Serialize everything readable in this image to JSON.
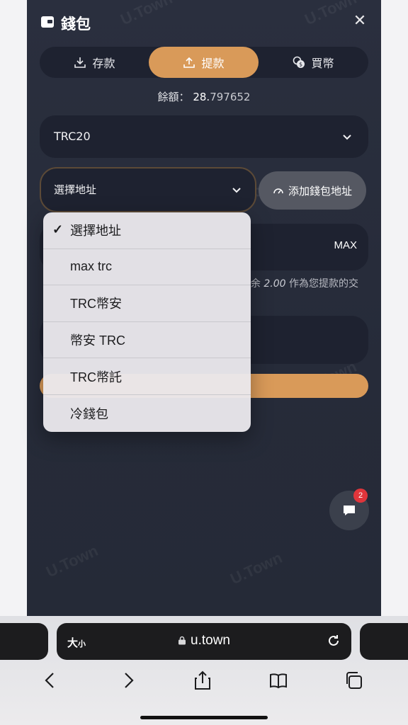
{
  "header": {
    "title": "錢包",
    "close_symbol": "✕"
  },
  "tabs": [
    {
      "label": "存款",
      "icon": "download-icon",
      "active": false
    },
    {
      "label": "提款",
      "icon": "upload-icon",
      "active": true
    },
    {
      "label": "買幣",
      "icon": "coin-exchange-icon",
      "active": false
    }
  ],
  "balance": {
    "label": "餘額：",
    "value_main": "28.",
    "value_decimals": "797652"
  },
  "network": {
    "selected": "TRC20"
  },
  "address": {
    "placeholder": "選擇地址",
    "add_button_label": "添加錢包地址"
  },
  "amount": {
    "max_label": "MAX"
  },
  "fee_note": {
    "prefix": "余",
    "value": "2.00",
    "suffix": "作為您提款的交"
  },
  "dropdown": {
    "selected_index": 0,
    "options": [
      "選擇地址",
      "max trc",
      "TRC幣安",
      "幣安 TRC",
      "TRC幣託",
      "冷錢包"
    ]
  },
  "chat": {
    "badge_count": "2"
  },
  "watermark": "U.Town",
  "browser": {
    "text_size_label": "大",
    "text_size_small": "小",
    "url": "u.town"
  },
  "colors": {
    "accent": "#d99a59",
    "background": "#2a2f3e",
    "field": "#1e2230",
    "badge": "#e0353b"
  }
}
